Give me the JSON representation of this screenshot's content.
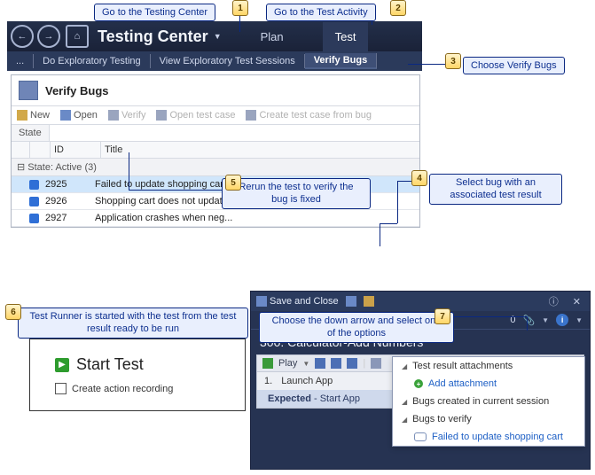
{
  "callouts": {
    "c1": "Go to the Testing Center",
    "c2": "Go to the Test Activity",
    "c3": "Choose Verify Bugs",
    "c4": "Select bug with an associated test result",
    "c5": "Rerun the test to verify the bug is fixed",
    "c6": "Test Runner is started with the test from the test result ready to be run",
    "c7": "Choose the down arrow and select one of the options"
  },
  "markers": {
    "m1": "1",
    "m2": "2",
    "m3": "3",
    "m4": "4",
    "m5": "5",
    "m6": "6",
    "m7": "7"
  },
  "header": {
    "app_title": "Testing Center",
    "tab_plan": "Plan",
    "tab_test": "Test"
  },
  "subnav": {
    "ellipsis": "...",
    "exploratory": "Do Exploratory Testing",
    "sessions": "View Exploratory Test Sessions",
    "verify": "Verify Bugs"
  },
  "panel": {
    "title": "Verify Bugs",
    "toolbar": {
      "new": "New",
      "open": "Open",
      "verify": "Verify",
      "open_test": "Open test case",
      "create_test": "Create test case from bug"
    },
    "state_label": "State",
    "columns": {
      "id": "ID",
      "title": "Title"
    },
    "group_label": "State: Active (3)",
    "rows": [
      {
        "id": "2925",
        "title": "Failed to update shopping cart"
      },
      {
        "id": "2926",
        "title": "Shopping cart does not update..."
      },
      {
        "id": "2927",
        "title": "Application crashes when neg..."
      }
    ]
  },
  "runner_box": {
    "start": "Start Test",
    "checkbox": "Create action recording"
  },
  "runner_win": {
    "save_close": "Save and Close",
    "count": "0",
    "title": "300: Calculator-Add Numbers",
    "play": "Play",
    "step_num": "1.",
    "step_text": "Launch App",
    "expected_label": "Expected",
    "expected_value": " - Start App"
  },
  "flyout": {
    "h1": "Test result attachments",
    "add": "Add attachment",
    "h2": "Bugs created in current session",
    "h3": "Bugs to verify",
    "bug_link": "Failed to update shopping cart"
  }
}
